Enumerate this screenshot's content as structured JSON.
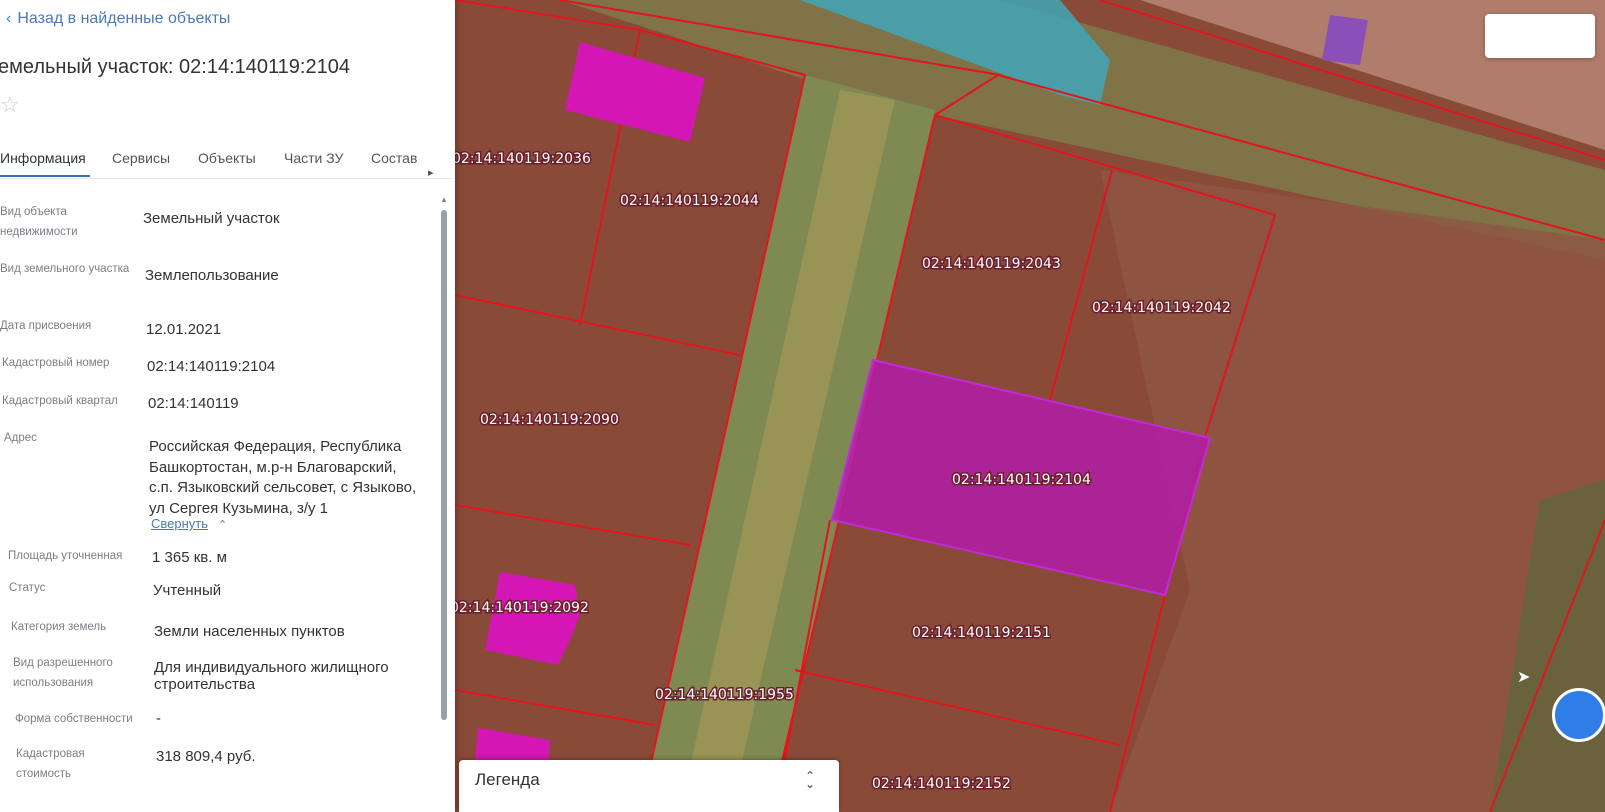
{
  "panel": {
    "back_link": "Назад в найденные объекты",
    "title": "емельный участок: 02:14:140119:2104",
    "tabs": [
      "Информация",
      "Сервисы",
      "Объекты",
      "Части ЗУ",
      "Состав"
    ],
    "active_tab": "Информация",
    "rows": [
      {
        "label": "Вид объекта недвижимости",
        "value": "Земельный участок"
      },
      {
        "label": "Вид земельного участка",
        "value": "Землепользование"
      },
      {
        "label": "Дата присвоения",
        "value": "12.01.2021"
      },
      {
        "label": "Кадастровый номер",
        "value": "02:14:140119:2104"
      },
      {
        "label": "Кадастровый квартал",
        "value": "02:14:140119"
      },
      {
        "label": "Адрес",
        "value": "Российская Федерация, Республика Башкортостан, м.р-н Благоварский, с.п. Языковский сельсовет, с Языково, ул Сергея Кузьмина, з/у 1"
      },
      {
        "label": "Площадь уточненная",
        "value": "1 365 кв. м"
      },
      {
        "label": "Статус",
        "value": "Учтенный"
      },
      {
        "label": "Категория земель",
        "value": "Земли населенных пунктов"
      },
      {
        "label": "Вид разрешенного использования",
        "value": "Для индивидуального жилищного строительства"
      },
      {
        "label": "Форма собственности",
        "value": "-"
      },
      {
        "label": "Кадастровая стоимость",
        "value": "318 809,4 руб."
      }
    ],
    "collapse_link": "Свернуть"
  },
  "map": {
    "legend_label": "Легенда",
    "parcel_labels": {
      "p2036": "02:14:140119:2036",
      "p2044": "02:14:140119:2044",
      "p2043": "02:14:140119:2043",
      "p2042": "02:14:140119:2042",
      "p2090": "02:14:140119:2090",
      "p2104": "02:14:140119:2104",
      "p2092": "02:14:140119:2092",
      "p2151": "02:14:140119:2151",
      "p1955": "02:14:140119:1955",
      "p2152": "02:14:140119:2152"
    },
    "colors": {
      "parcel_fill": "#a8503f",
      "boundary": "#e3141e",
      "selected": "#b21ca8",
      "building": "#d316b4",
      "water": "#3fa6b9",
      "road_strip": "#7f8a52"
    }
  }
}
